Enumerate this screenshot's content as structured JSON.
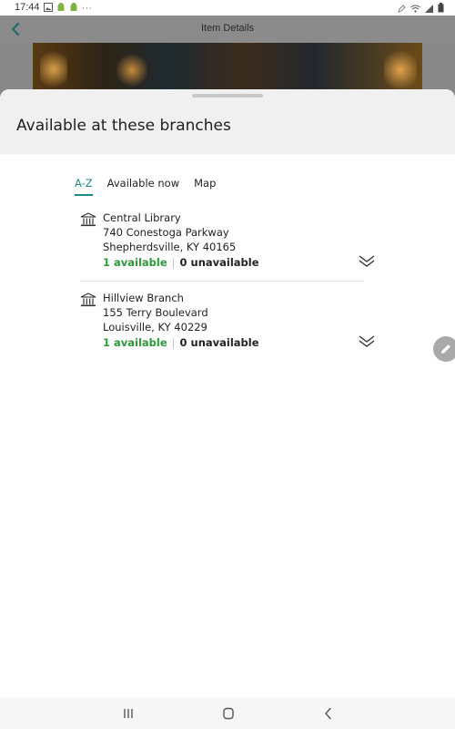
{
  "status_bar": {
    "time": "17:44",
    "left_icons": [
      "image-notification-icon",
      "android-icon",
      "android-icon"
    ],
    "more": "···",
    "right_icons": [
      "pen-icon",
      "wifi-icon",
      "signal-icon",
      "battery-icon"
    ]
  },
  "app_bar": {
    "back_icon": "chevron-left-icon",
    "title": "Item Details"
  },
  "sheet": {
    "title": "Available at these branches"
  },
  "tabs": [
    {
      "label": "A-Z",
      "active": true
    },
    {
      "label": "Available now",
      "active": false
    },
    {
      "label": "Map",
      "active": false
    }
  ],
  "branches": [
    {
      "icon": "library-building-icon",
      "name": "Central Library",
      "address1": "740 Conestoga Parkway",
      "address2": "Shepherdsville, KY 40165",
      "available": "1 available",
      "separator": "|",
      "unavailable": "0 unavailable",
      "expand_icon": "double-chevron-down-icon"
    },
    {
      "icon": "library-building-icon",
      "name": "Hillview Branch",
      "address1": "155 Terry Boulevard",
      "address2": "Louisville, KY 40229",
      "available": "1 available",
      "separator": "|",
      "unavailable": "0 unavailable",
      "expand_icon": "double-chevron-down-icon"
    }
  ],
  "fab": {
    "icon": "pencil-icon"
  },
  "nav_bar": [
    "recent-apps-icon",
    "home-icon",
    "back-icon"
  ],
  "colors": {
    "accent": "#1f8a8a",
    "available": "#2e9a3a",
    "sheet_header_bg": "#f0f0f0"
  }
}
